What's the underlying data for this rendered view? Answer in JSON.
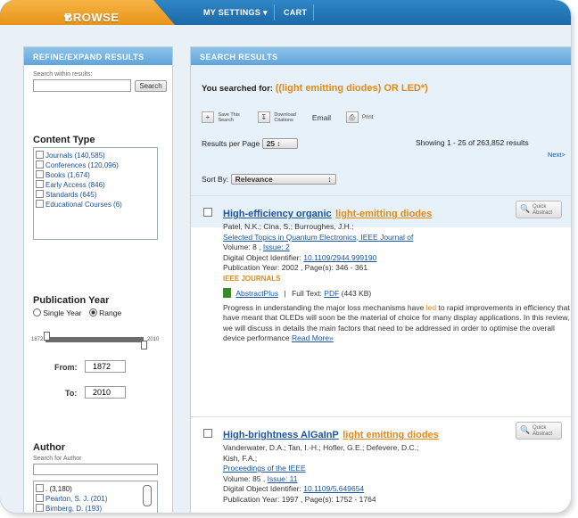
{
  "topnav": {
    "browse_label": "BROWSE",
    "my_settings_label": "MY SETTINGS",
    "cart_label": "CART"
  },
  "refine": {
    "header": "REFINE/EXPAND RESULTS",
    "search_within_label": "Search within results:",
    "search_within_value": "",
    "search_button": "Search",
    "content_type_title": "Content Type",
    "content_types": [
      {
        "label": "Journals (140,585)"
      },
      {
        "label": "Conferences (120,096)"
      },
      {
        "label": "Books (1,674)"
      },
      {
        "label": "Early Access (846)"
      },
      {
        "label": "Standards (645)"
      },
      {
        "label": "Educational Courses (6)"
      }
    ],
    "pub_year_title": "Publication Year",
    "single_year_label": "Single Year",
    "range_label": "Range",
    "slider_min": "1872",
    "slider_max": "2010",
    "from_label": "From:",
    "from_value": "1872",
    "to_label": "To:",
    "to_value": "2010",
    "author_title": "Author",
    "search_author_label": "Search for Author",
    "search_author_value": "",
    "authors": [
      {
        "label": ". (3,180)"
      },
      {
        "label": "Pearton, S. J. (201)"
      },
      {
        "label": "Bimberg, D. (193)"
      }
    ]
  },
  "results": {
    "header": "SEARCH RESULTS",
    "searched_for_label": "You searched for:",
    "query": "((light emitting diodes) OR LED*)",
    "tools": {
      "save_search": "Save This Search",
      "download_citations": "Download Citations",
      "email": "Email",
      "print": "Print"
    },
    "per_page_label": "Results per Page",
    "per_page_value": "25",
    "showing_text": "Showing 1 - 25 of 263,852 results",
    "next_label": "Next>",
    "sort_by_label": "Sort By:",
    "sort_by_value": "Relevance",
    "quick_abstract": "Quick Abstract",
    "items": [
      {
        "title_plain": "High-efficiency organic",
        "title_highlight": "light-emitting diodes",
        "authors": "Patel, N.K.; Cina, S.; Burroughes, J.H.;",
        "journal": "Selected Topics in Quantum Electronics, IEEE Journal of",
        "volume_label": "Volume: 8 ,",
        "issue_link": "Issue: 2",
        "doi_label": "Digital Object Identifier:",
        "doi": "10.1109/2944.999190",
        "pub_info": "Publication Year: 2002 , Page(s): 346 - 361",
        "source": "IEEE JOURNALS",
        "abstractplus": "AbstractPlus",
        "fulltext_label": "Full Text:",
        "pdf_link": "PDF",
        "pdf_size": "(443 KB)",
        "abstract_before": "Progress in understanding the major loss mechanisms have",
        "abstract_highlight": "led",
        "abstract_after": "to rapid improvements in efficiency that have meant that OLEDs will soon be the material of choice for many display applications. In this review, we will discuss in details the main factors that need to be addressed in order to optimise the overall device performance",
        "read_more": "Read More»"
      },
      {
        "title_plain": "High-brightness AlGaInP",
        "title_highlight": "light emitting diodes",
        "authors": "Vanderwater, D.A.; Tan, I.-H.; Hofler, G.E.; Defevere, D.C.;",
        "authors2": "Kish, F.A.;",
        "journal": "Proceedings of the IEEE",
        "volume_label": "Volume: 85 ,",
        "issue_link": "Issue: 11",
        "doi_label": "Digital Object Identifier:",
        "doi": "10.1109/5.649654",
        "pub_info": "Publication Year: 1997 , Page(s): 1752 - 1764"
      }
    ]
  }
}
